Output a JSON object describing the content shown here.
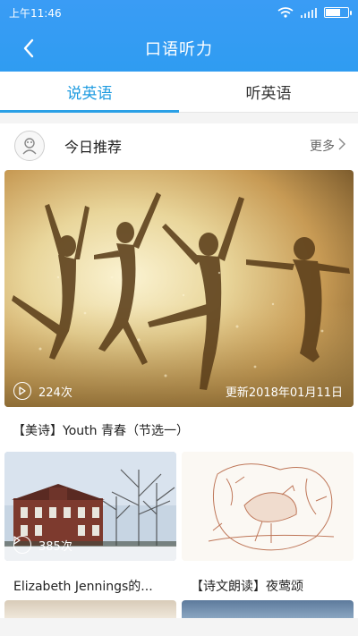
{
  "status": {
    "time": "上午11:46"
  },
  "nav": {
    "title": "口语听力"
  },
  "tabs": [
    {
      "label": "说英语",
      "active": true
    },
    {
      "label": "听英语",
      "active": false
    }
  ],
  "section": {
    "title": "今日推荐",
    "more_label": "更多"
  },
  "hero": {
    "plays": "224次",
    "date": "更新2018年01月11日",
    "caption": "【美诗】Youth 青春（节选一）"
  },
  "cards": [
    {
      "plays": "385次",
      "title": "Elizabeth Jennings的..."
    },
    {
      "plays": "",
      "title": "【诗文朗读】夜莺颂"
    }
  ],
  "colors": {
    "accent": "#2aa0e6",
    "header": "#3a9cf5"
  }
}
